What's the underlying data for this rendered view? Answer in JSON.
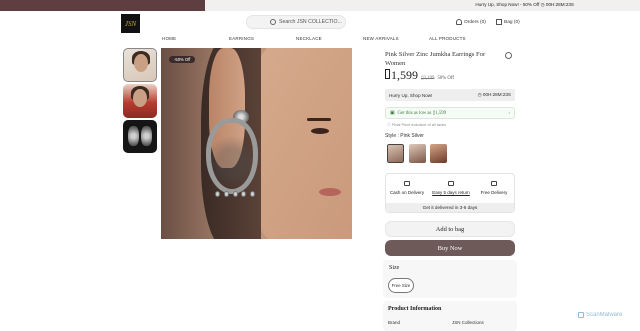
{
  "topbar": {
    "text": "Hurry Up, Shop Now! - 50% Off  ◷ 00H:28M:23S"
  },
  "header": {
    "logo_text": "JSN",
    "search_placeholder": "Search JSN COLLECTIO...",
    "orders_label": "Orders (0)",
    "bag_label": "Bag (0)"
  },
  "nav": {
    "items": [
      "HOME",
      "EARRINGS",
      "NECKLACE",
      "NEW ARRIVALS",
      "ALL PRODUCTS"
    ]
  },
  "gallery": {
    "badge": "-50% Off"
  },
  "product": {
    "title": "Pink Silver Zinc Jumkha Earrings For Women",
    "price": "1,599",
    "mrp": "3,199",
    "discount": "50% Off"
  },
  "hurry": {
    "text": "Hurry Up, Shop Now!",
    "timer": "◷ 00H:28M:23S"
  },
  "offer": {
    "text": "Get this as low as ▯1,599",
    "note": "Final Price inclusive of all taxes"
  },
  "style": {
    "label": "Style : Pink Silver"
  },
  "features": {
    "cod": "Cash on Delivery",
    "returns": "Easy 5 days return",
    "free": "Free Delivery",
    "delivery": "Get it delivered in 3-6 days"
  },
  "actions": {
    "add_to_bag": "Add to bag",
    "buy_now": "Buy Now"
  },
  "size": {
    "label": "Size",
    "option": "Free Size"
  },
  "info": {
    "title": "Product Information",
    "brand_key": "Brand",
    "brand_val": "JSN Collections"
  },
  "watermark": {
    "text": "ScanMalware"
  }
}
